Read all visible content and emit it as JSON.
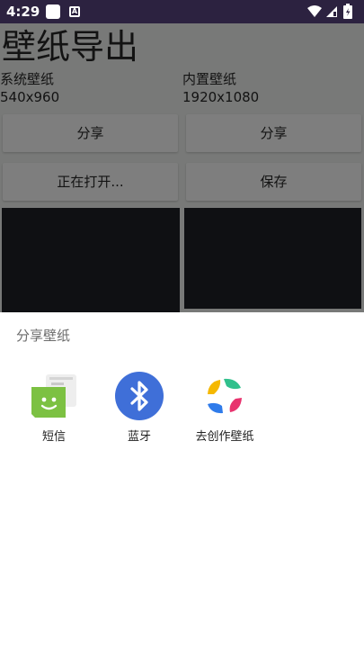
{
  "status_bar": {
    "time": "4:29",
    "app_icon_b_letter": "A",
    "icons": [
      "notification-app-icon",
      "notification-app-icon",
      "wifi-icon",
      "cellular-icon",
      "battery-icon"
    ]
  },
  "app": {
    "title": "壁纸导出",
    "left": {
      "name": "系统壁纸",
      "size": "540x960"
    },
    "right": {
      "name": "内置壁纸",
      "size": "1920x1080"
    },
    "buttons": {
      "share_left": "分享",
      "share_right": "分享",
      "opening": "正在打开...",
      "save": "保存"
    }
  },
  "sheet": {
    "title": "分享壁纸",
    "targets": [
      {
        "label": "短信",
        "icon": "messaging-icon"
      },
      {
        "label": "蓝牙",
        "icon": "bluetooth-icon"
      },
      {
        "label": "去创作壁纸",
        "icon": "wallpaper-creator-icon"
      }
    ]
  },
  "colors": {
    "status_bar": "#2c2240",
    "bluetooth": "#3f6fd8",
    "messaging": "#7cc142"
  }
}
